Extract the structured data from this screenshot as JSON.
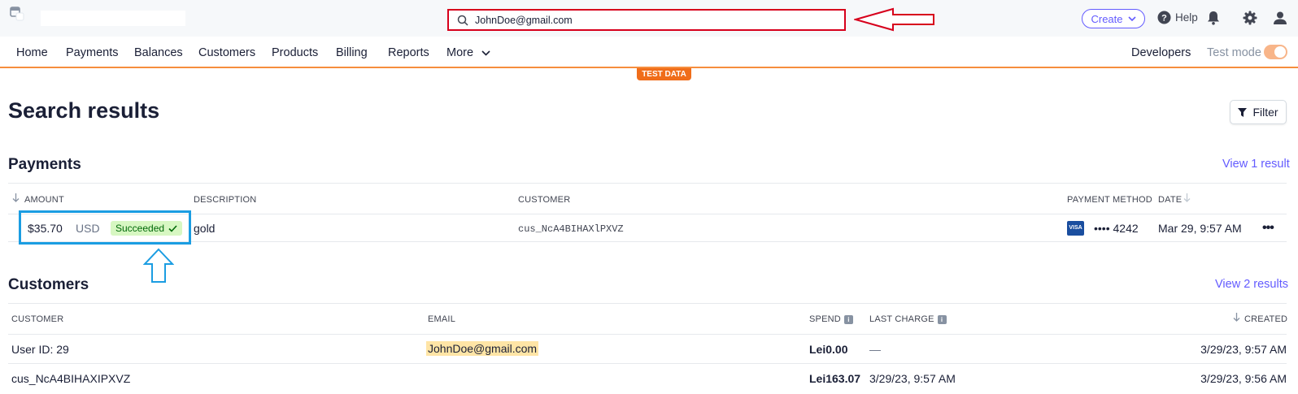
{
  "search": {
    "value": "JohnDoe@gmail.com"
  },
  "topbar": {
    "create_label": "Create",
    "help_label": "Help"
  },
  "nav": {
    "items": [
      "Home",
      "Payments",
      "Balances",
      "Customers",
      "Products",
      "Billing",
      "Reports",
      "More"
    ],
    "developers": "Developers",
    "test_mode": "Test mode",
    "test_badge": "TEST DATA"
  },
  "page": {
    "title": "Search results",
    "filter_label": "Filter"
  },
  "payments": {
    "title": "Payments",
    "view_link": "View 1 result",
    "columns": {
      "amount": "AMOUNT",
      "description": "DESCRIPTION",
      "customer": "CUSTOMER",
      "payment_method": "PAYMENT METHOD",
      "date": "DATE"
    },
    "row": {
      "amount": "$35.70",
      "currency": "USD",
      "status": "Succeeded",
      "description": "gold",
      "customer": "cus_NcA4BIHAXlPXVZ",
      "card_brand": "VISA",
      "card_last4": "•••• 4242",
      "date": "Mar 29, 9:57 AM"
    }
  },
  "customers": {
    "title": "Customers",
    "view_link": "View 2 results",
    "columns": {
      "customer": "CUSTOMER",
      "email": "EMAIL",
      "spend": "SPEND",
      "last_charge": "LAST CHARGE",
      "created": "CREATED"
    },
    "rows": [
      {
        "customer": "User ID: 29",
        "email": "JohnDoe@gmail.com",
        "spend": "Lei0.00",
        "last_charge": "—",
        "created": "3/29/23, 9:57 AM"
      },
      {
        "customer": "cus_NcA4BIHAXIPXVZ",
        "email": "",
        "spend": "Lei163.07",
        "last_charge": "3/29/23, 9:57 AM",
        "created": "3/29/23, 9:56 AM"
      }
    ]
  },
  "colors": {
    "accent": "#635bff",
    "test_orange": "#f06d1a",
    "success_bg": "#d7f7c2",
    "annotation_red": "#d7001c",
    "annotation_blue": "#1b9de2"
  }
}
